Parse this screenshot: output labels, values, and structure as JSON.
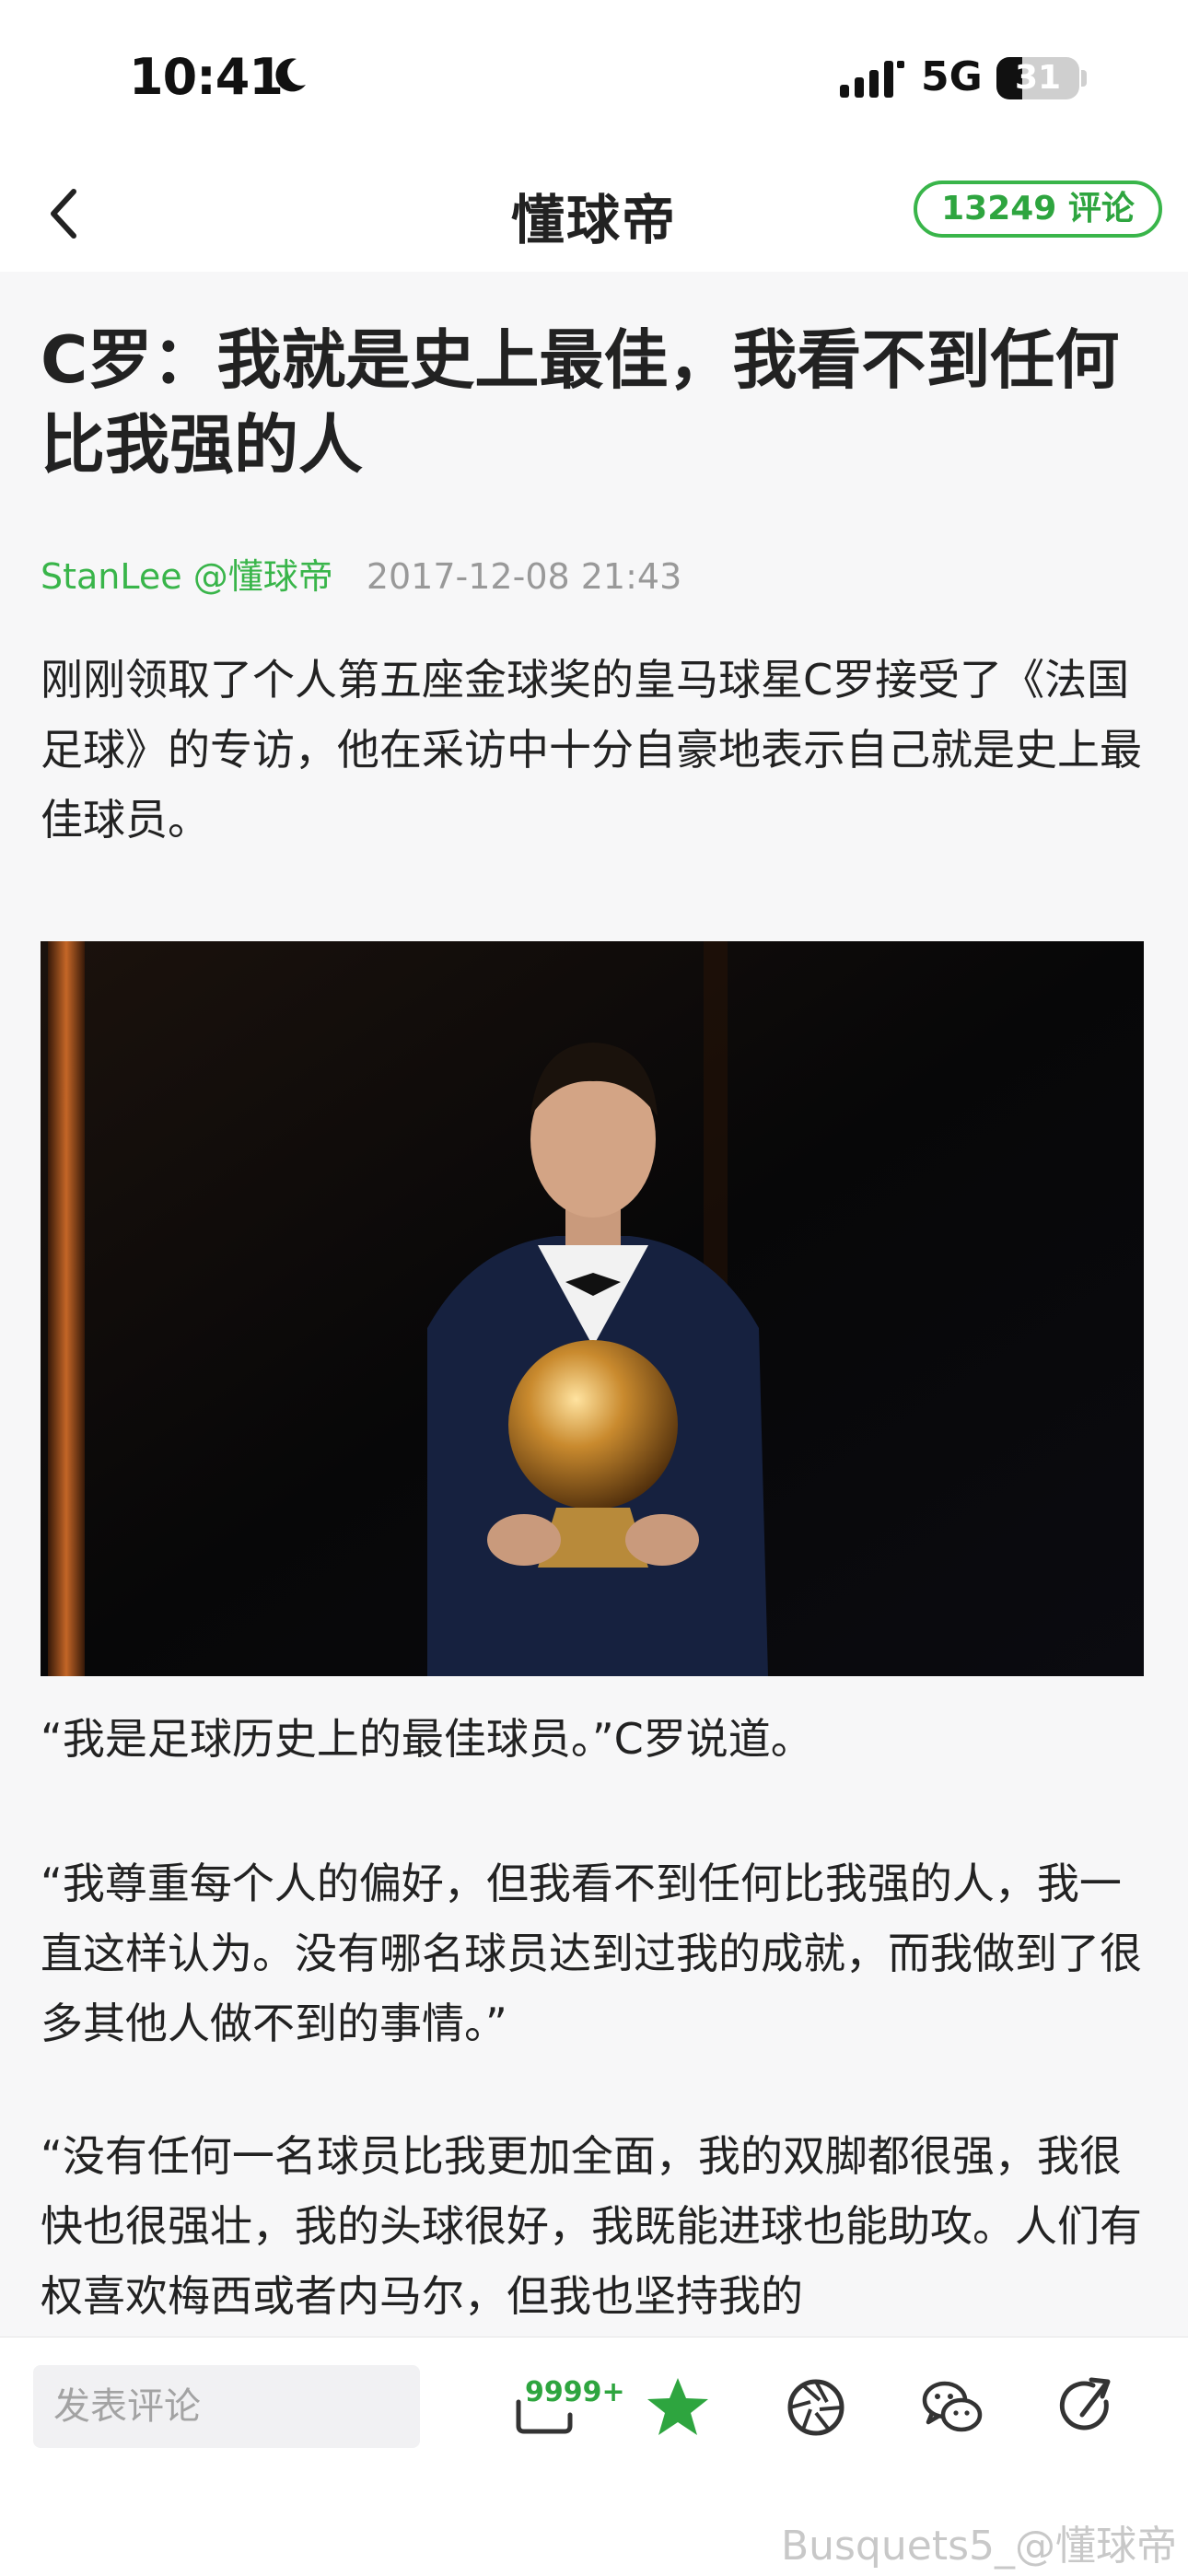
{
  "status_bar": {
    "time": "10:41",
    "network": "5G",
    "battery": "31",
    "battery_level": 0.31
  },
  "nav": {
    "brand": "懂球帝",
    "comment_count": "13249 评论"
  },
  "article": {
    "title": "C罗：我就是史上最佳，我看不到任何比我强的人",
    "author": "StanLee @懂球帝",
    "date": "2017-12-08 21:43",
    "paragraphs": [
      "刚刚领取了个人第五座金球奖的皇马球星C罗接受了《法国足球》的专访，他在采访中十分自豪地表示自己就是史上最佳球员。",
      "“我是足球历史上的最佳球员。”C罗说道。",
      "“我尊重每个人的偏好，但我看不到任何比我强的人，我一直这样认为。没有哪名球员达到过我的成就，而我做到了很多其他人做不到的事情。”",
      "“没有任何一名球员比我更加全面，我的双脚都很强，我很快也很强壮，我的头球很好，我既能进球也能助攻。人们有权喜欢梅西或者内马尔，但我也坚持我的"
    ]
  },
  "bottom_bar": {
    "comment_placeholder": "发表评论",
    "comment_badge": "9999+",
    "icons": [
      "comment-icon",
      "star-icon",
      "aperture-icon",
      "wechat-icon",
      "share-icon"
    ],
    "accent_color": "#2ea53f"
  },
  "watermark": "Busquets5_@懂球帝"
}
